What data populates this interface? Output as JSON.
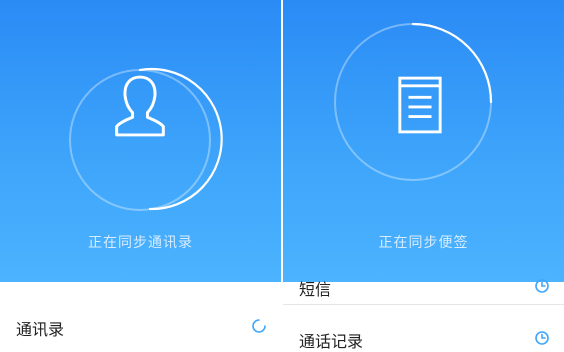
{
  "left_panel": {
    "status_text": "正在同步通讯录",
    "list": [
      {
        "label": "通讯录",
        "indicator": "loading-spinner-icon"
      }
    ]
  },
  "right_panel": {
    "status_text": "正在同步便签",
    "list": [
      {
        "label": "短信",
        "indicator": "clock-icon"
      },
      {
        "label": "通话记录",
        "indicator": "clock-icon"
      }
    ]
  },
  "colors": {
    "header_blue": "#2a8bf5",
    "ring": "#cfe8ff",
    "icon": "#ffffff",
    "accent": "#3fa6fb"
  }
}
